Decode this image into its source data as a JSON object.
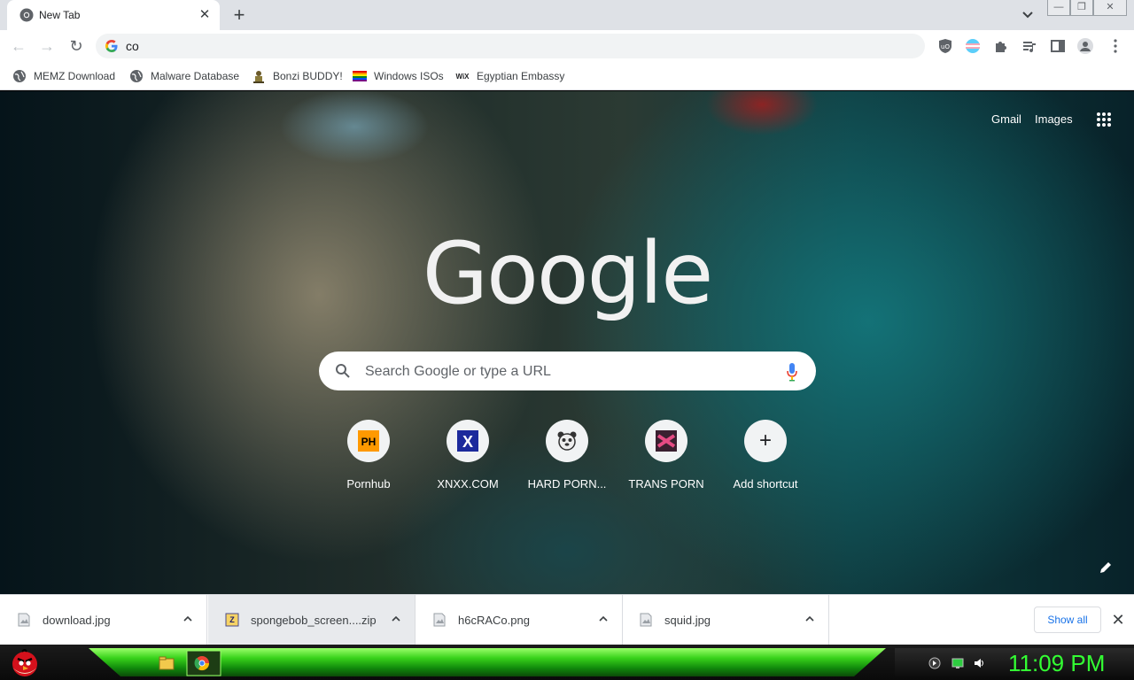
{
  "tab": {
    "title": "New Tab"
  },
  "omnibox": {
    "value": "co"
  },
  "bookmarks": [
    {
      "label": "MEMZ Download",
      "icon": "globe-icon"
    },
    {
      "label": "Malware Database",
      "icon": "globe-icon"
    },
    {
      "label": "Bonzi BUDDY!",
      "icon": "bonzi-icon"
    },
    {
      "label": "Windows ISOs",
      "icon": "rainbow-flag-icon"
    },
    {
      "label": "Egyptian Embassy",
      "icon": "wix-icon"
    }
  ],
  "ntp": {
    "gmail": "Gmail",
    "images": "Images",
    "logo": "Google",
    "search_placeholder": "Search Google or type a URL",
    "shortcuts": [
      {
        "label": "Pornhub",
        "badge": "PH"
      },
      {
        "label": "XNXX.COM",
        "badge": "X"
      },
      {
        "label": "HARD PORN...",
        "badge": ""
      },
      {
        "label": "TRANS PORN",
        "badge": ""
      },
      {
        "label": "Add shortcut",
        "badge": "+"
      }
    ]
  },
  "downloads": {
    "items": [
      {
        "name": "download.jpg"
      },
      {
        "name": "spongebob_screen....zip"
      },
      {
        "name": "h6cRACo.png"
      },
      {
        "name": "squid.jpg"
      }
    ],
    "show_all": "Show all"
  },
  "taskbar": {
    "clock": "11:09 PM"
  },
  "colors": {
    "accent": "#1a73e8",
    "clock": "#33ff33",
    "taskbar_green": "#38d21b"
  }
}
